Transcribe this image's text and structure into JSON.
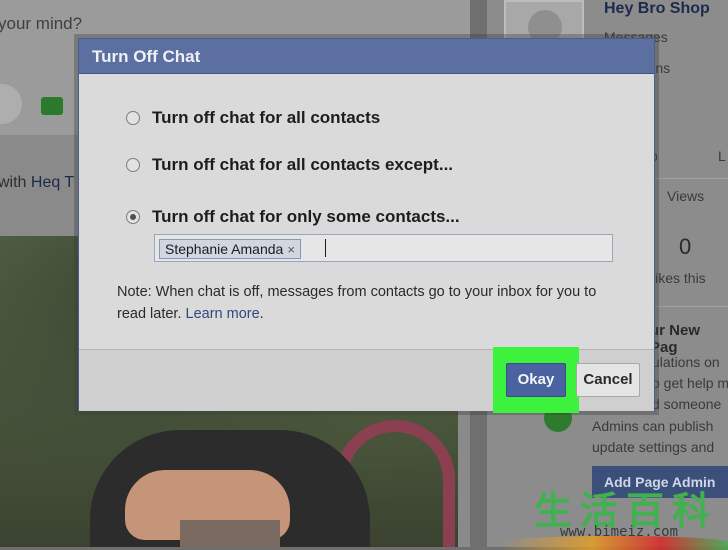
{
  "background": {
    "composer_prompt": "your mind?",
    "with_prefix": "with",
    "with_link": "Heq T",
    "page_name": "Hey Bro Shop",
    "messages": "Messages",
    "notifications": "otifications",
    "to_label": "o",
    "l_label": "L",
    "views_label": "Views",
    "likes_count": "0",
    "likes_text": "likes this",
    "new_page_title": "ur New Pag",
    "congrats_line": "ulations on",
    "help_line": "o get help m",
    "someone_line": "d someone",
    "admins_line1": "Admins can publish",
    "admins_line2": "update settings and",
    "add_admin_button": "Add Page Admin"
  },
  "watermark": {
    "chars": "生活百科",
    "url": "www.bimeiz.com"
  },
  "dialog": {
    "title": "Turn Off Chat",
    "options": [
      {
        "label": "Turn off chat for all contacts",
        "selected": false
      },
      {
        "label": "Turn off chat for all contacts except...",
        "selected": false
      },
      {
        "label": "Turn off chat for only some contacts...",
        "selected": true
      }
    ],
    "contacts_input": {
      "tokens": [
        "Stephanie Amanda"
      ],
      "value": ""
    },
    "note_text": "Note: When chat is off, messages from contacts go to your inbox for you to read later. ",
    "note_link": "Learn more",
    "note_end": ".",
    "okay_label": "Okay",
    "cancel_label": "Cancel",
    "highlight_color": "#3cf23c"
  }
}
